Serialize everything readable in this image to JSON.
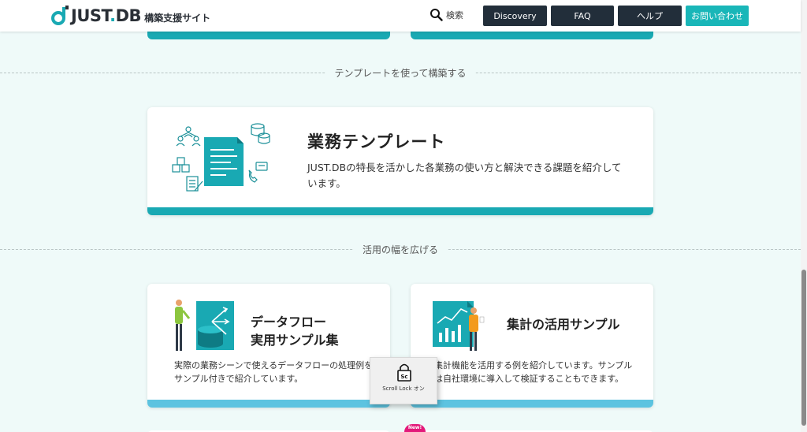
{
  "header": {
    "logo_main": "JUST",
    "logo_dot": ".",
    "logo_db": "DB",
    "logo_sub": "構築支援サイト",
    "search_label": "検索",
    "nav": {
      "discovery": "Discovery",
      "faq": "FAQ",
      "help": "ヘルプ",
      "contact": "お問い合わせ"
    }
  },
  "sections": {
    "template_heading": "テンプレートを使って構築する",
    "usage_heading": "活用の幅を広げる"
  },
  "business_template": {
    "title": "業務テンプレート",
    "description": "JUST.DBの特長を活かした各業務の使い方と解決できる課題を紹介しています。"
  },
  "dataflow_card": {
    "title_line1": "データフロー",
    "title_line2": "実用サンプル集",
    "description": "実際の業務シーンで使えるデータフローの処理例をサンプル付きで紹介しています。"
  },
  "aggregate_card": {
    "title": "集計の活用サンプル",
    "description": "集計機能を活用する例を紹介しています。サンプルは自社環境に導入して検証することもできます。"
  },
  "overlay": {
    "icon_text": "Sc",
    "label": "Scroll Lock オン"
  },
  "badge": {
    "label": "New!"
  },
  "colors": {
    "teal": "#19a9b3",
    "navy": "#222e3a",
    "contact": "#19b6b8",
    "light_blue": "#5cc3e0",
    "bg": "#effaf9",
    "badge": "#e3197a"
  }
}
